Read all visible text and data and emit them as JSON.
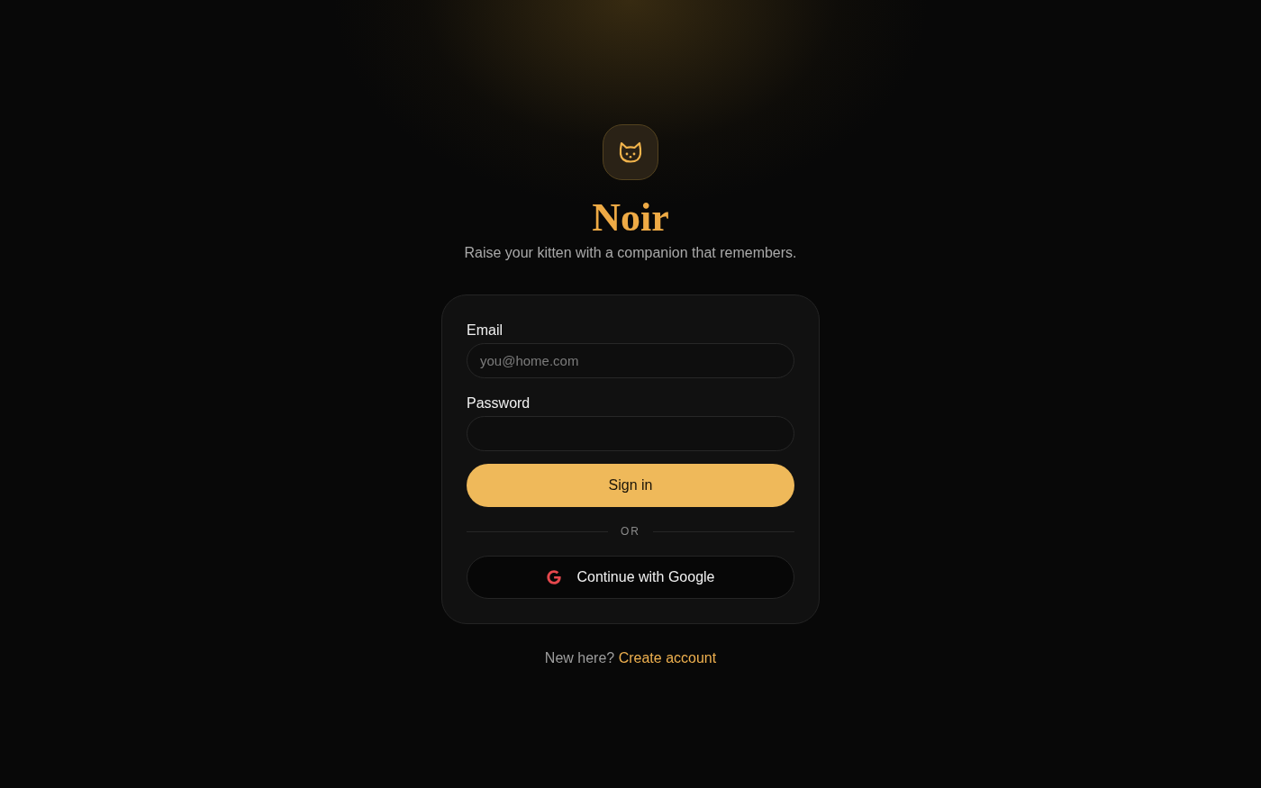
{
  "brand": {
    "name": "Noir",
    "tagline": "Raise your kitten with a companion that remembers."
  },
  "form": {
    "fields": [
      {
        "label": "Email",
        "placeholder": "you@home.com"
      },
      {
        "label": "Password"
      }
    ],
    "submit": "Sign in",
    "divider": "OR",
    "google_button": "Continue with Google"
  },
  "footer": {
    "prompt": "New here?",
    "link": "Create account"
  }
}
